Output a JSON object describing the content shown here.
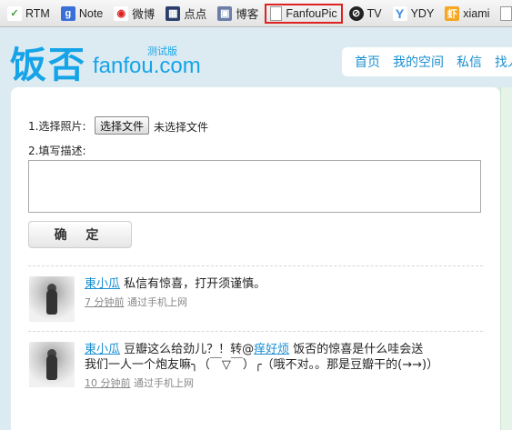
{
  "bookmarks": [
    {
      "label": "RTM",
      "icon": "rtm-icon",
      "glyph": "✓"
    },
    {
      "label": "Note",
      "icon": "google-note-icon",
      "glyph": "g"
    },
    {
      "label": "微博",
      "icon": "weibo-icon",
      "glyph": "◉"
    },
    {
      "label": "点点",
      "icon": "diandian-icon",
      "glyph": "▦"
    },
    {
      "label": "博客",
      "icon": "blog-icon",
      "glyph": "▣"
    },
    {
      "label": "FanfouPic",
      "icon": "page-icon",
      "glyph": ""
    },
    {
      "label": "TV",
      "icon": "tv-icon",
      "glyph": "⊘"
    },
    {
      "label": "YDY",
      "icon": "ydy-icon",
      "glyph": "Y"
    },
    {
      "label": "xiami",
      "icon": "xiami-icon",
      "glyph": "虾"
    },
    {
      "label": "",
      "icon": "page-icon",
      "glyph": ""
    }
  ],
  "header": {
    "logo_zh": "饭否",
    "logo_en": "fanfou.com",
    "beta": "测试版",
    "nav": [
      "首页",
      "我的空间",
      "私信",
      "找人"
    ]
  },
  "form": {
    "select_photo_label": "1.选择照片:",
    "choose_file_button": "选择文件",
    "file_status": "未选择文件",
    "description_label": "2.填写描述:",
    "description_value": "",
    "confirm_button": "确 定"
  },
  "statuses": [
    {
      "author": "東小瓜",
      "text_before": " 私信有惊喜，打开须谨慎。",
      "mention": "",
      "text_after": "",
      "time": "7 分钟前",
      "via": "通过手机上网"
    },
    {
      "author": "東小瓜",
      "text_before": " 豆瓣这么给劲儿？！转@",
      "mention": "痒好烦",
      "text_after": " 饭否的惊喜是什么哇会送我们一人一个炮友嘛╮（￣▽￣）╭（哦不对。。那是豆瓣干的(→→)）",
      "time": "10 分钟前",
      "via": "通过手机上网"
    }
  ]
}
